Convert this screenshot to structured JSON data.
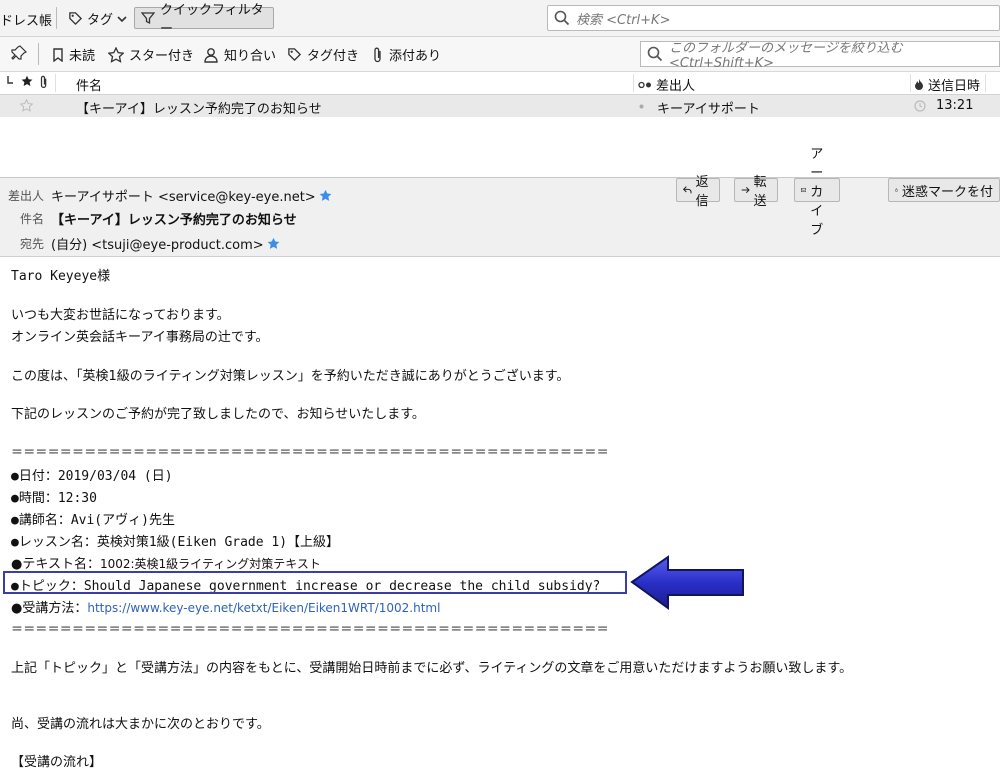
{
  "toolbar": {
    "address_book": "ドレス帳",
    "tag_label": "タグ",
    "quick_filter_label": "クイックフィルター",
    "search_placeholder": "検索 <Ctrl+K>"
  },
  "filter_bar": {
    "unread": "未読",
    "starred": "スター付き",
    "contacts": "知り合い",
    "tagged": "タグ付き",
    "attachment": "添付あり",
    "folder_search_placeholder": "このフォルダーのメッセージを絞り込む <Ctrl+Shift+K>"
  },
  "thread_list": {
    "columns": {
      "subject": "件名",
      "from": "差出人",
      "date": "送信日時"
    },
    "rows": [
      {
        "subject": "【キーアイ】レッスン予約完了のお知らせ",
        "from": "キーアイサポート",
        "date": "13:21"
      }
    ]
  },
  "message": {
    "from_label": "差出人",
    "from_value": "キーアイサポート <service@key-eye.net>",
    "subject_label": "件名",
    "subject_value": "【キーアイ】レッスン予約完了のお知らせ",
    "to_label": "宛先",
    "to_value": "(自分) <tsuji@eye-product.com>",
    "actions": {
      "reply": "返信",
      "forward": "転送",
      "archive": "アーカイブ",
      "junk": "迷惑マークを付"
    }
  },
  "body": {
    "greeting": "Taro Keyeye様",
    "line1": "いつも大変お世話になっております。",
    "line2": "オンライン英会話キーアイ事務局の辻です。",
    "line3": "この度は、「英検1級のライティング対策レッスン」を予約いただき誠にありがとうございます。",
    "line4": "下記のレッスンのご予約が完了致しましたので、お知らせいたします。",
    "separator": "＝＝＝＝＝＝＝＝＝＝＝＝＝＝＝＝＝＝＝＝＝＝＝＝＝＝＝＝＝＝＝＝＝＝＝＝＝＝＝＝＝＝＝＝＝＝＝＝＝",
    "date": "●日付：2019/03/04 (日)",
    "time": "●時間：12:30",
    "teacher": "●講師名：Avi(アヴィ)先生",
    "lesson": "●レッスン名：英検対策1級(Eiken Grade 1)【上級】",
    "text_label": "●テキスト名：",
    "text_value": "1002:英検1級ライティング対策テキスト",
    "topic": "●トピック：Should Japanese government increase or decrease the child subsidy?",
    "method_label": "●受講方法：",
    "method_url": "https://www.key-eye.net/ketxt/Eiken/Eiken1WRT/1002.html",
    "line5": "上記「トピック」と「受講方法」の内容をもとに、受講開始日時前までに必ず、ライティングの文章をご用意いただけますようお願い致します。",
    "line6": "尚、受講の流れは大まかに次のとおりです。",
    "line7": "【受講の流れ】"
  },
  "colors": {
    "accent_blue": "#3a3fa8",
    "star_blue": "#3b8eea",
    "link": "#2d63b8"
  }
}
